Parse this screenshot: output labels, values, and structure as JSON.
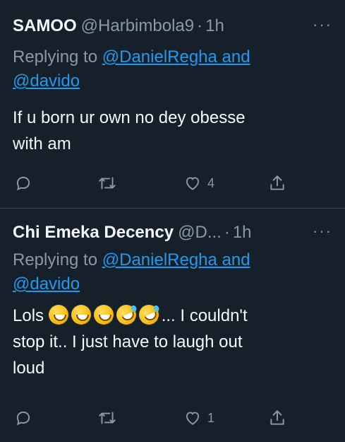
{
  "tweets": [
    {
      "name": "SAMOO",
      "handle": "@Harbimbola9",
      "dot": "·",
      "time": "1h",
      "more": "···",
      "replying_prefix": "Replying to ",
      "replying_line1_link": "@DanielRegha and",
      "replying_line2_link": "@davido",
      "body_lines": [
        "If u born ur own no dey obesse",
        "with am"
      ],
      "likes": "4",
      "retweets": "",
      "replies": ""
    },
    {
      "name": "Chi Emeka Decency",
      "handle": "@D...",
      "dot": "·",
      "time": "1h",
      "more": "···",
      "replying_prefix": "Replying to ",
      "replying_line1_link": "@DanielRegha and",
      "replying_line2_link": "@davido",
      "body_prefix": "Lols ",
      "body_suffix": "... I couldn't",
      "body_lines": [
        "stop it.. I just have to laugh out",
        "loud"
      ],
      "emojis": [
        "grinning-squinting-face",
        "grinning-squinting-face",
        "grinning-squinting-face",
        "rolling-on-floor-laughing",
        "rolling-on-floor-laughing"
      ],
      "likes": "1",
      "retweets": "",
      "replies": ""
    }
  ],
  "colors": {
    "background": "#15202b",
    "text": "#f7f9f9",
    "secondary": "#8b98a5",
    "link": "#1d9bf0",
    "divider": "#38444d"
  }
}
